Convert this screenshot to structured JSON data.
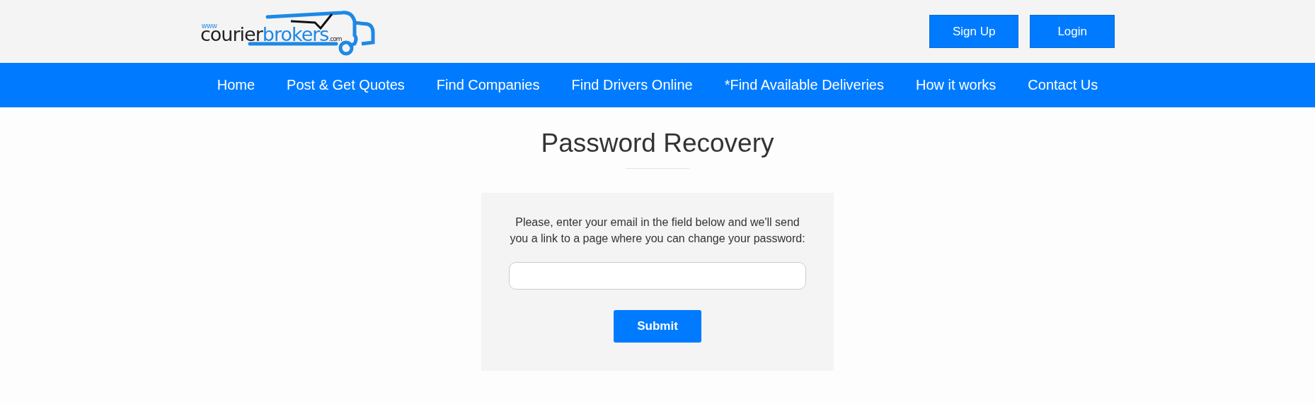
{
  "logo": {
    "prefix": "www",
    "word1": "courier",
    "word2": "brokers",
    "suffix": ".com"
  },
  "header_buttons": [
    "Sign Up",
    "Login"
  ],
  "nav": [
    "Home",
    "Post & Get Quotes",
    "Find Companies",
    "Find Drivers Online",
    "*Find Available Deliveries",
    "How it works",
    "Contact Us"
  ],
  "title": "Password Recovery",
  "form": {
    "instructions": "Please, enter your email in the field below and we'll send you a link to a page where you can change your password:",
    "submit": "Submit"
  }
}
